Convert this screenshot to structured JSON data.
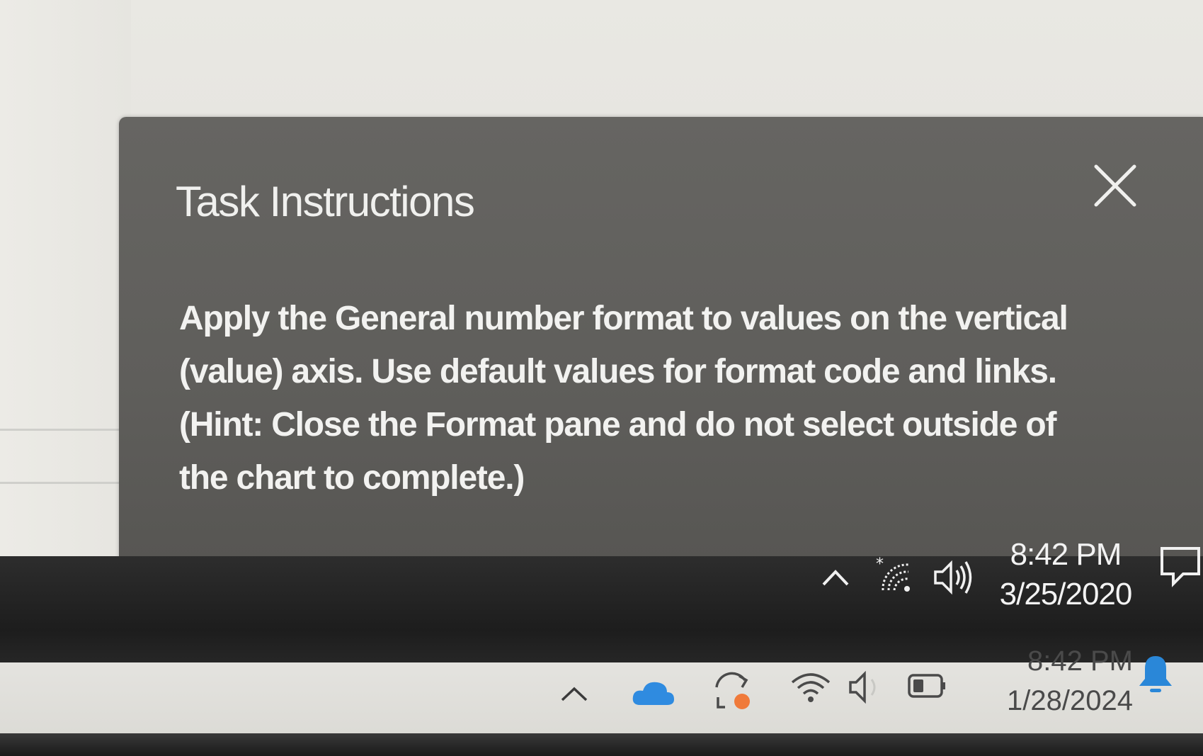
{
  "task_panel": {
    "title": "Task Instructions",
    "instruction_line1": "Apply the General number format to values on the vertical",
    "instruction_line2": "(value) axis. Use default values for format code and links.",
    "instruction_line3": "(Hint: Close the Format pane and do not select outside of",
    "instruction_line4": "the chart to complete.)",
    "close_icon": "close-icon"
  },
  "inner_taskbar": {
    "time": "8:42 PM",
    "date": "3/25/2020",
    "icons": [
      "chevron-up-icon",
      "wifi-icon",
      "volume-icon",
      "notification-icon"
    ]
  },
  "outer_taskbar": {
    "time": "8:42 PM",
    "date": "1/28/2024",
    "icons": [
      "chevron-up-icon",
      "onedrive-cloud-icon",
      "sync-icon",
      "wifi-icon",
      "volume-icon",
      "battery-icon",
      "bell-icon"
    ]
  },
  "colors": {
    "panel_bg": "#616060",
    "panel_text": "#f2f2f0",
    "dark_taskbar": "#222222",
    "light_taskbar": "#e0dfdb",
    "onedrive_blue": "#2f8be0",
    "sync_orange": "#f07a3a",
    "bell_blue": "#2a87d8"
  }
}
